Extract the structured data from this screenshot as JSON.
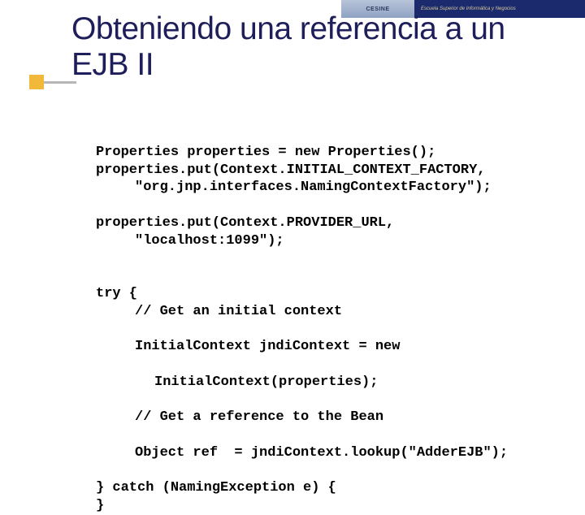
{
  "header": {
    "logo_text": "CESINE",
    "strip_text": "Escuela Superior de Informática y Negocios"
  },
  "slide": {
    "title": "Obteniendo una referencia a un EJB II"
  },
  "code": {
    "l1": "Properties properties = new Properties();",
    "l2": "properties.put(Context.INITIAL_CONTEXT_FACTORY,",
    "l3": "\"org.jnp.interfaces.NamingContextFactory\");",
    "l4": "properties.put(Context.PROVIDER_URL,",
    "l5": "\"localhost:1099\");",
    "l6": "",
    "l7": "try {",
    "l8": "// Get an initial context",
    "l9": "InitialContext jndiContext = new",
    "l10": "InitialContext(properties);",
    "l11": "// Get a reference to the Bean",
    "l12": "Object ref  = jndiContext.lookup(\"AdderEJB\");",
    "l13": "} catch (NamingException e) {",
    "l14": "}"
  }
}
